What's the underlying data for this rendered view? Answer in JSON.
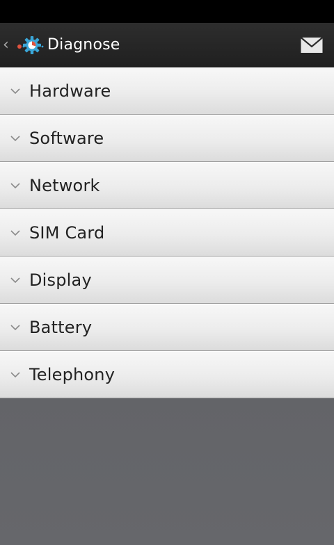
{
  "action_bar": {
    "title": "Diagnose",
    "back_icon": "chevron-left-icon",
    "app_icon": "diagnose-gear-icon",
    "action_icon": "mail-icon"
  },
  "categories": [
    {
      "label": "Hardware",
      "icon": "chevron-down-icon"
    },
    {
      "label": "Software",
      "icon": "chevron-down-icon"
    },
    {
      "label": "Network",
      "icon": "chevron-down-icon"
    },
    {
      "label": "SIM Card",
      "icon": "chevron-down-icon"
    },
    {
      "label": "Display",
      "icon": "chevron-down-icon"
    },
    {
      "label": "Battery",
      "icon": "chevron-down-icon"
    },
    {
      "label": "Telephony",
      "icon": "chevron-down-icon"
    }
  ],
  "colors": {
    "action_bar": "#222222",
    "list_item": "#ececec",
    "background": "#616266",
    "gear_accent": "#3aa6d8",
    "dot_accent": "#e0533f"
  }
}
